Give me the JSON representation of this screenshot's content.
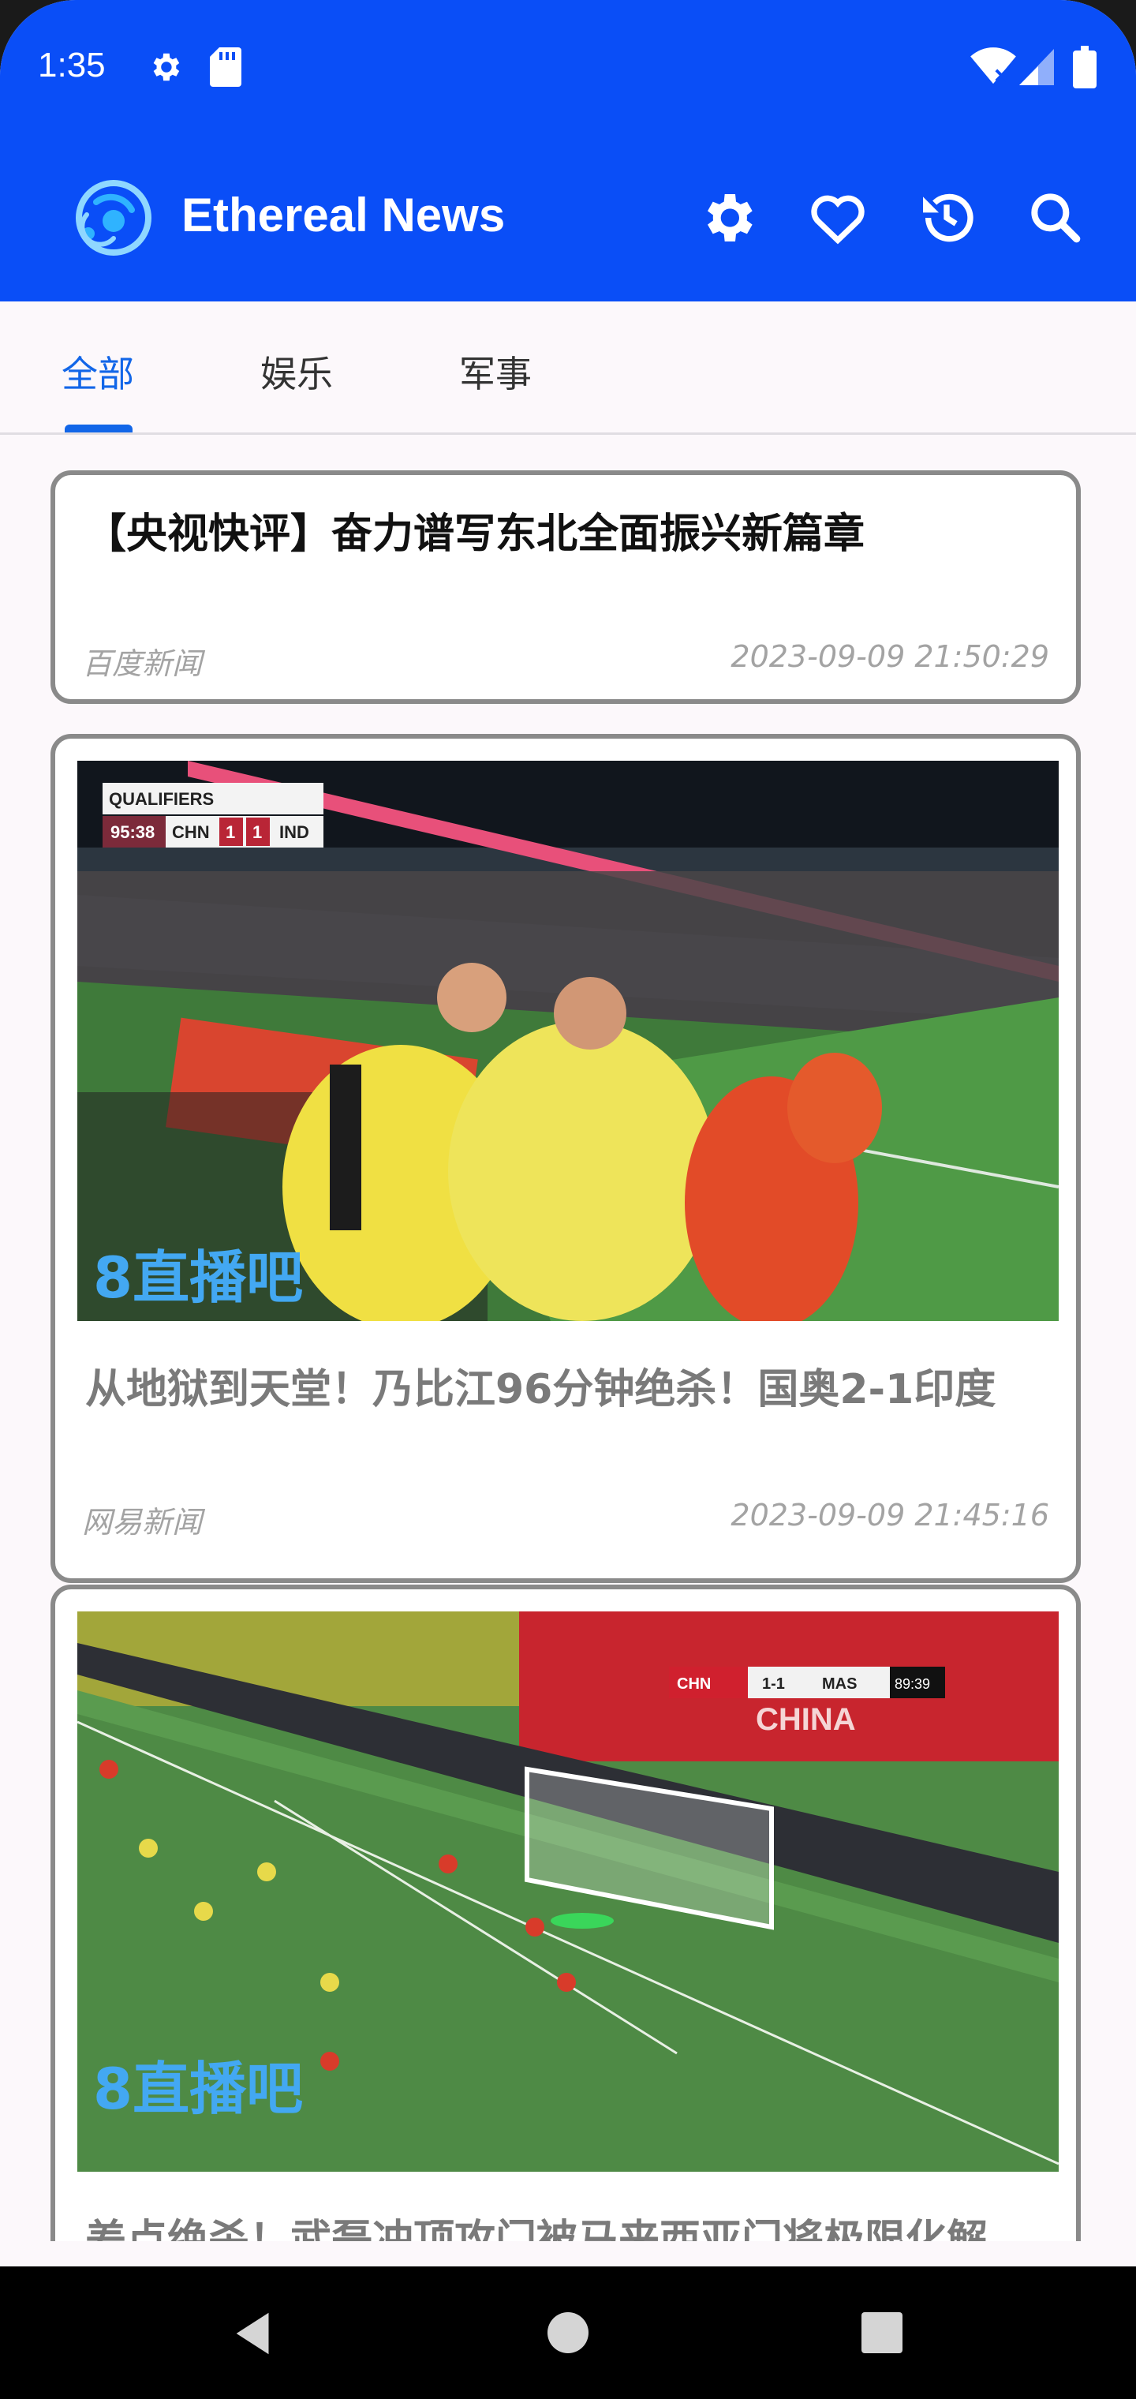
{
  "status_bar": {
    "time": "1:35"
  },
  "app_bar": {
    "title": "Ethereal News",
    "actions": [
      "settings-icon",
      "favorite-icon",
      "history-icon",
      "search-icon"
    ]
  },
  "tabs": [
    {
      "label": "全部",
      "active": true
    },
    {
      "label": "娱乐",
      "active": false
    },
    {
      "label": "军事",
      "active": false
    }
  ],
  "news": [
    {
      "title": "【央视快评】奋力谱写东北全面振兴新篇章",
      "source": "百度新闻",
      "time": "2023-09-09 21:50:29",
      "has_image": false
    },
    {
      "title": "从地狱到天堂！乃比江96分钟绝杀！国奥2-1印度",
      "source": "网易新闻",
      "time": "2023-09-09 21:45:16",
      "has_image": true,
      "image": {
        "scoreboard": {
          "label": "QUALIFIERS",
          "clock": "95:38",
          "home": "CHN",
          "home_score": "1",
          "away_score": "1",
          "away": "IND"
        },
        "watermark": "8直播吧"
      }
    },
    {
      "title": "差点绝杀！武磊冲顶攻门被马来西亚门将极限化解",
      "has_image": true,
      "image": {
        "scoreboard": {
          "home": "CHN",
          "score": "1-1",
          "away": "MAS",
          "clock": "89:39"
        },
        "banner": "CHINA",
        "watermark": "8直播吧"
      }
    }
  ],
  "colors": {
    "primary": "#0a4ef7",
    "tab_active": "#1266e8"
  }
}
